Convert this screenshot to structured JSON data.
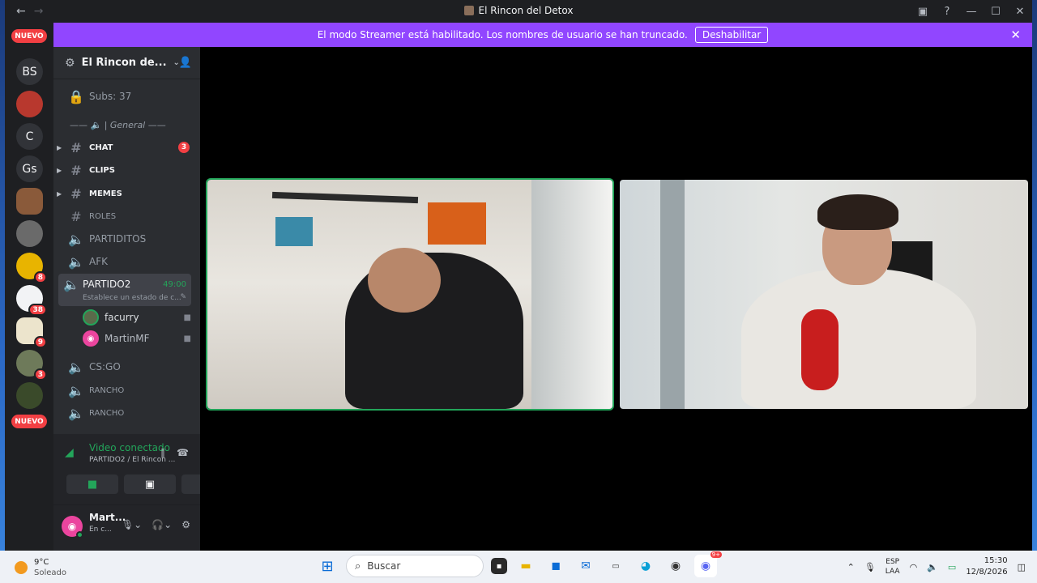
{
  "window": {
    "title": "El Rincon del Detox",
    "back": "←",
    "forward": "→"
  },
  "banner": {
    "text": "El modo Streamer está habilitado. Los nombres de usuario se han truncado.",
    "button": "Deshabilitar"
  },
  "guilds": {
    "new_label_top": "NUEVO",
    "new_label_bottom": "NUEVO",
    "items": [
      {
        "label": "BS"
      },
      {
        "label": "C"
      },
      {
        "label": "Gs"
      }
    ],
    "badges": [
      "8",
      "38",
      "9",
      "3"
    ]
  },
  "server": {
    "name": "El Rincon de...",
    "subs_channel": "Subs: 37",
    "category": "—— 🔈 | General ——"
  },
  "channels": [
    {
      "name": "CHAT",
      "type": "text",
      "unread": true,
      "count": "3"
    },
    {
      "name": "CLIPS",
      "type": "text",
      "unread": true
    },
    {
      "name": "MEMES",
      "type": "text",
      "unread": true
    },
    {
      "name": "ROLES",
      "type": "text"
    },
    {
      "name": "PARTIDITOS",
      "type": "voice"
    },
    {
      "name": "AFK",
      "type": "voice"
    }
  ],
  "active_voice": {
    "name": "PARTIDO2",
    "time": "49:00",
    "status": "Establece un estado de c..."
  },
  "members": [
    {
      "name": "facurry"
    },
    {
      "name": "MartinMF"
    }
  ],
  "more_channels": [
    {
      "name": "CS:GO"
    },
    {
      "name": "RANCHO"
    },
    {
      "name": "RANCHO"
    }
  ],
  "voice_panel": {
    "title": "Video conectado",
    "subtitle": "PARTIDO2 / El Rincon ..."
  },
  "user_panel": {
    "name": "Mart...",
    "status": "En c..."
  },
  "taskbar": {
    "temperature": "9°C",
    "weather": "Soleado",
    "search_placeholder": "Buscar",
    "lang_top": "ESP",
    "lang_bottom": "LAA",
    "time": "15:30",
    "date": "12/8/2026",
    "discord_badge": "9+"
  },
  "colors": {
    "accent": "#9146ff",
    "speaking": "#23a55a",
    "badge": "#f23f43"
  }
}
